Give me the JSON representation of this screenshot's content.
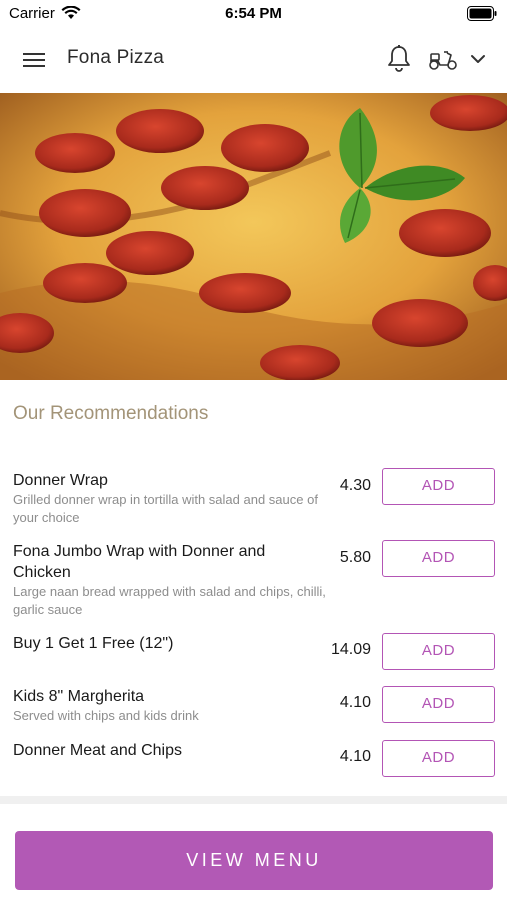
{
  "status_bar": {
    "carrier": "Carrier",
    "time": "6:54 PM"
  },
  "header": {
    "title": "Fona Pizza",
    "icons": [
      "menu-icon",
      "bell-icon",
      "scooter-icon",
      "chevron-down-icon"
    ]
  },
  "hero": {
    "image": "pepperoni-pizza-photo"
  },
  "recommendations": {
    "title": "Our Recommendations",
    "items": [
      {
        "name": "Donner Wrap",
        "description": "Grilled donner wrap in tortilla with salad and sauce of your choice",
        "price": "4.30",
        "action": "ADD"
      },
      {
        "name": "Fona Jumbo Wrap with Donner and Chicken",
        "description": "Large naan bread wrapped with salad and chips, chilli, garlic sauce",
        "price": "5.80",
        "action": "ADD"
      },
      {
        "name": "Buy 1 Get 1 Free (12\")",
        "description": "",
        "price": "14.09",
        "action": "ADD"
      },
      {
        "name": "Kids 8\" Margherita",
        "description": "Served with chips and kids drink",
        "price": "4.10",
        "action": "ADD"
      },
      {
        "name": "Donner Meat and Chips",
        "description": "",
        "price": "4.10",
        "action": "ADD"
      }
    ]
  },
  "footer": {
    "view_menu_label": "VIEW MENU"
  },
  "colors": {
    "accent": "#b355b5",
    "section_title": "#a39478",
    "description": "#8d8d8d"
  }
}
